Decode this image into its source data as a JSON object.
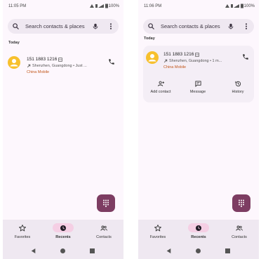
{
  "left": {
    "status": {
      "time": "11:05 PM",
      "battery": "100%"
    },
    "search": {
      "placeholder": "Search contacts & places"
    },
    "section_title": "Today",
    "call": {
      "number": "151 1883 1216",
      "detail": "Shenzhen, Guangdong • Just ...",
      "carrier": "China Mobile"
    },
    "nav": {
      "favorites": "Favorites",
      "recents": "Recents",
      "contacts": "Contacts"
    }
  },
  "right": {
    "status": {
      "time": "11:06 PM",
      "battery": "100%"
    },
    "search": {
      "placeholder": "Search contacts & places"
    },
    "section_title": "Today",
    "call": {
      "number": "151 1883 1216",
      "detail": "Shenzhen, Guangdong • 1 m...",
      "carrier": "China Mobile"
    },
    "actions": {
      "add_contact": "Add contact",
      "message": "Message",
      "history": "History"
    },
    "nav": {
      "favorites": "Favorites",
      "recents": "Recents",
      "contacts": "Contacts"
    }
  },
  "colors": {
    "avatar": "#f7c02d",
    "carrier": "#c2571b",
    "fab": "#7d3d62",
    "active_pill": "#f5cfe4",
    "background": "#fdf7fd"
  },
  "icons": {
    "search": "search-icon",
    "mic": "mic-icon",
    "more": "more-vert-icon",
    "call": "phone-icon",
    "dialpad": "dialpad-icon",
    "favorites": "star-icon",
    "recents": "clock-icon",
    "contacts": "people-icon"
  }
}
